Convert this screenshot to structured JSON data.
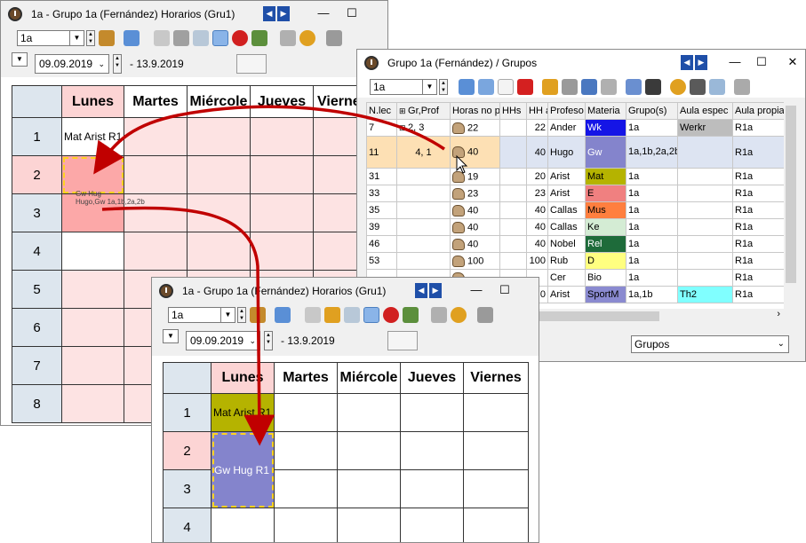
{
  "w1": {
    "title": "1a - Grupo 1a (Fernández)  Horarios  (Gru1)",
    "combo": "1a",
    "date": "09.09.2019",
    "date_end": "- 13.9.2019",
    "days": [
      "Lunes",
      "Martes",
      "Miércole",
      "Jueves",
      "Viernes"
    ],
    "periods": [
      "1",
      "2",
      "3",
      "4",
      "5",
      "6",
      "7",
      "8"
    ],
    "c1": "Mat Arist R1",
    "c2a": "Gw Hug",
    "c2b": "Hugo,Gw  1a,1b,2a,2b"
  },
  "w2": {
    "title": "Grupo 1a (Fernández) / Grupos",
    "combo": "1a",
    "headers": [
      "N.lec",
      "Gr,Prof",
      "Horas no p",
      "HHs",
      "HH a",
      "Profeso",
      "Materia",
      "Grupo(s)",
      "Aula espec",
      "Aula propia"
    ],
    "rows": [
      {
        "n": "7",
        "gp": "2, 3",
        "h": "22",
        "hh": "",
        "hha": "22",
        "prof": "Ander",
        "mat": "Wk",
        "mc": "#1515e6",
        "mt": "#fff",
        "grp": "1a",
        "aula": "Werkr",
        "ac": "#bdbdbd",
        "ap": "R1a",
        "tall": false,
        "sel": false
      },
      {
        "n": "11",
        "gp": "4, 1",
        "h": "40",
        "hh": "",
        "hha": "40",
        "prof": "Hugo",
        "mat": "Gw",
        "mc": "#8484cc",
        "mt": "#fff",
        "grp": "1a,1b,2a,2b",
        "aula": "",
        "ac": "",
        "ap": "R1a",
        "tall": true,
        "sel": true
      },
      {
        "n": "31",
        "gp": "",
        "h": "19",
        "hh": "",
        "hha": "20",
        "prof": "Arist",
        "mat": "Mat",
        "mc": "#b5b300",
        "mt": "#000",
        "grp": "1a",
        "aula": "",
        "ac": "",
        "ap": "R1a",
        "tall": false,
        "sel": false
      },
      {
        "n": "33",
        "gp": "",
        "h": "23",
        "hh": "",
        "hha": "23",
        "prof": "Arist",
        "mat": "E",
        "mc": "#f08080",
        "mt": "#000",
        "grp": "1a",
        "aula": "",
        "ac": "",
        "ap": "R1a",
        "tall": false,
        "sel": false
      },
      {
        "n": "35",
        "gp": "",
        "h": "40",
        "hh": "",
        "hha": "40",
        "prof": "Callas",
        "mat": "Mus",
        "mc": "#ff7f3f",
        "mt": "#000",
        "grp": "1a",
        "aula": "",
        "ac": "",
        "ap": "R1a",
        "tall": false,
        "sel": false
      },
      {
        "n": "39",
        "gp": "",
        "h": "40",
        "hh": "",
        "hha": "40",
        "prof": "Callas",
        "mat": "Ke",
        "mc": "#d4ecd4",
        "mt": "#000",
        "grp": "1a",
        "aula": "",
        "ac": "",
        "ap": "R1a",
        "tall": false,
        "sel": false
      },
      {
        "n": "46",
        "gp": "",
        "h": "40",
        "hh": "",
        "hha": "40",
        "prof": "Nobel",
        "mat": "Rel",
        "mc": "#1e6b3a",
        "mt": "#fff",
        "grp": "1a",
        "aula": "",
        "ac": "",
        "ap": "R1a",
        "tall": false,
        "sel": false
      },
      {
        "n": "53",
        "gp": "",
        "h": "100",
        "hh": "",
        "hha": "100",
        "prof": "Rub",
        "mat": "D",
        "mc": "#ffff80",
        "mt": "#000",
        "grp": "1a",
        "aula": "",
        "ac": "",
        "ap": "R1a",
        "tall": false,
        "sel": false
      },
      {
        "n": "",
        "gp": "",
        "h": "",
        "hh": "",
        "hha": "",
        "prof": "Cer",
        "mat": "Bio",
        "mc": "",
        "mt": "#000",
        "grp": "1a",
        "aula": "",
        "ac": "",
        "ap": "R1a",
        "tall": false,
        "sel": false
      },
      {
        "n": "",
        "gp": "",
        "h": "",
        "hh": "",
        "hha": "0",
        "prof": "Arist",
        "mat": "SportM",
        "mc": "#8a8ad0",
        "mt": "#000",
        "grp": "1a,1b",
        "aula": "Th2",
        "ac": "#80ffff",
        "ap": "R1a",
        "tall": false,
        "sel": false
      }
    ],
    "bottom_combo": "Grupos"
  },
  "w3": {
    "title": "1a - Grupo 1a (Fernández)  Horarios  (Gru1)",
    "combo": "1a",
    "date": "09.09.2019",
    "date_end": "- 13.9.2019",
    "days": [
      "Lunes",
      "Martes",
      "Miércole",
      "Jueves",
      "Viernes"
    ],
    "periods": [
      "1",
      "2",
      "3",
      "4"
    ],
    "c1": "Mat Arist  R1",
    "c2": "Gw Hug  R1"
  },
  "colors": {
    "arrow": "#c00000",
    "lesson_mat": "#b5b300",
    "lesson_gw": "#8484cc",
    "dash": "#ffd21f",
    "pink": "#fde3e3",
    "selrow": "#fde0b4"
  }
}
